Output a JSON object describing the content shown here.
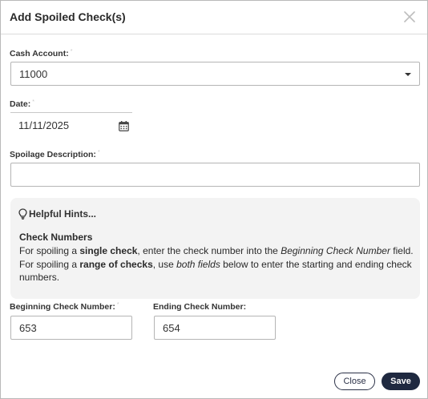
{
  "dialog": {
    "title": "Add Spoiled Check(s)",
    "close_icon": "close-icon"
  },
  "form": {
    "cash_account": {
      "label": "Cash Account:",
      "required_mark": "*",
      "value": "11000"
    },
    "date": {
      "label": "Date:",
      "required_mark": "*",
      "value": "11/11/2025",
      "icon": "calendar-icon"
    },
    "spoilage_description": {
      "label": "Spoilage Description:",
      "required_mark": "*",
      "value": ""
    },
    "beginning_check_number": {
      "label": "Beginning Check Number:",
      "required_mark": "*",
      "value": "653"
    },
    "ending_check_number": {
      "label": "Ending Check Number:",
      "value": "654"
    }
  },
  "hints": {
    "title": "Helpful Hints...",
    "icon": "lightbulb-icon",
    "subtitle": "Check Numbers",
    "t1": "For spoiling a ",
    "b1": "single check",
    "t2": ", enter the check number into the ",
    "i1": "Beginning Check Number",
    "t3": " field. For spoiling a ",
    "b2": "range of checks",
    "t4": ", use ",
    "i2": "both fields",
    "t5": " below to enter the starting and ending check numbers."
  },
  "footer": {
    "close_label": "Close",
    "save_label": "Save"
  },
  "colors": {
    "primary": "#1f2940",
    "hint_bg": "#f3f3f3",
    "border": "#b5b5b5"
  }
}
